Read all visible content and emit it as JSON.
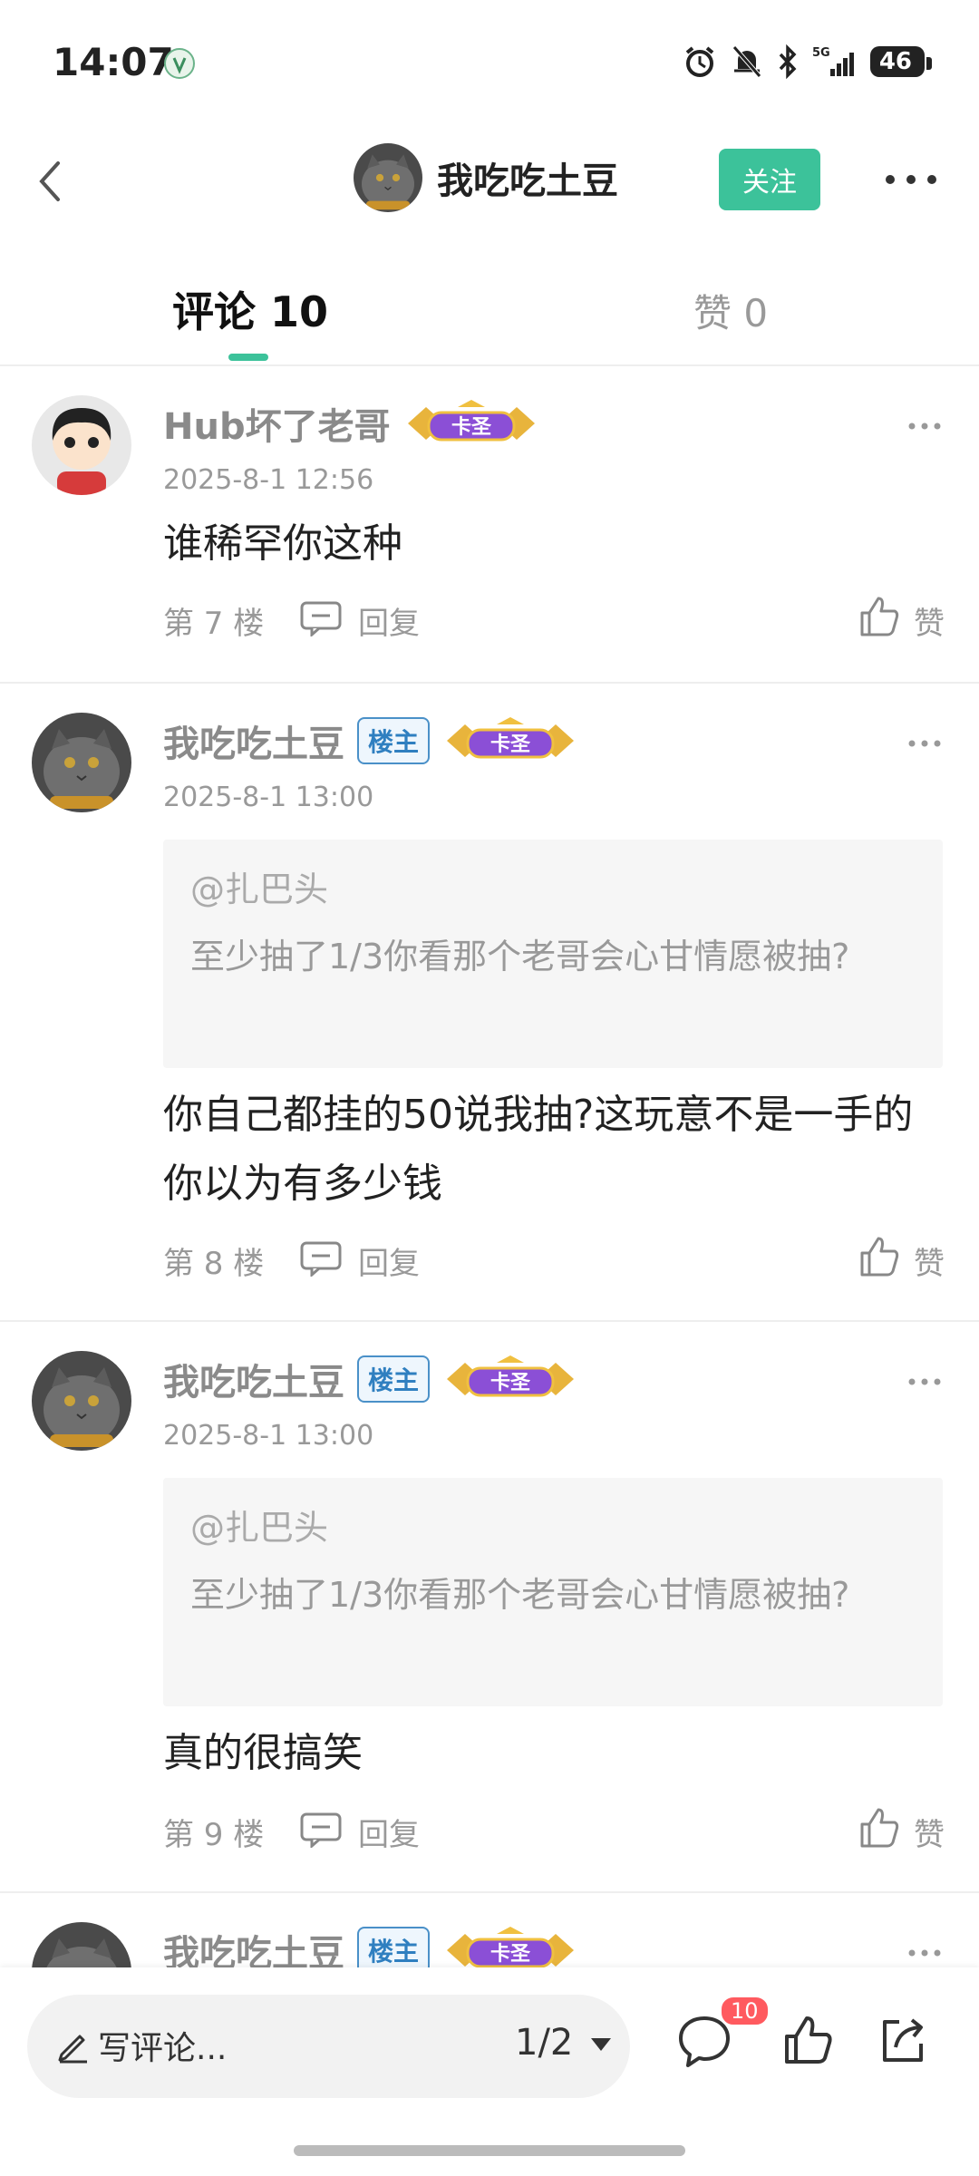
{
  "status_bar": {
    "time": "14:07",
    "battery": "46",
    "network": "5G"
  },
  "header": {
    "title": "我吃吃土豆",
    "follow_label": "关注"
  },
  "tabs": {
    "comments_label": "评论 10",
    "likes_label": "赞 0"
  },
  "accent_color": "#3cc29a",
  "comments": [
    {
      "user": "Hub坏了老哥",
      "rank": "卡圣",
      "time": "2025-8-1 12:56",
      "text": "谁稀罕你这种",
      "floor": "第 7 楼",
      "reply": "回复",
      "like": "赞"
    },
    {
      "user": "我吃吃土豆",
      "owner": "楼主",
      "rank": "卡圣",
      "time": "2025-8-1 13:00",
      "quote_user": "@扎巴头",
      "quote_text": "至少抽了1/3你看那个老哥会心甘情愿被抽?",
      "text": "你自己都挂的50说我抽?这玩意不是一手的你以为有多少钱",
      "floor": "第 8 楼",
      "reply": "回复",
      "like": "赞"
    },
    {
      "user": "我吃吃土豆",
      "owner": "楼主",
      "rank": "卡圣",
      "time": "2025-8-1 13:00",
      "quote_user": "@扎巴头",
      "quote_text": "至少抽了1/3你看那个老哥会心甘情愿被抽?",
      "text": "真的很搞笑",
      "floor": "第 9 楼",
      "reply": "回复",
      "like": "赞"
    },
    {
      "user": "我吃吃土豆",
      "owner": "楼主",
      "rank": "卡圣"
    }
  ],
  "bottom_bar": {
    "input_placeholder": "写评论...",
    "page_indicator": "1/2",
    "comment_count": "10"
  }
}
